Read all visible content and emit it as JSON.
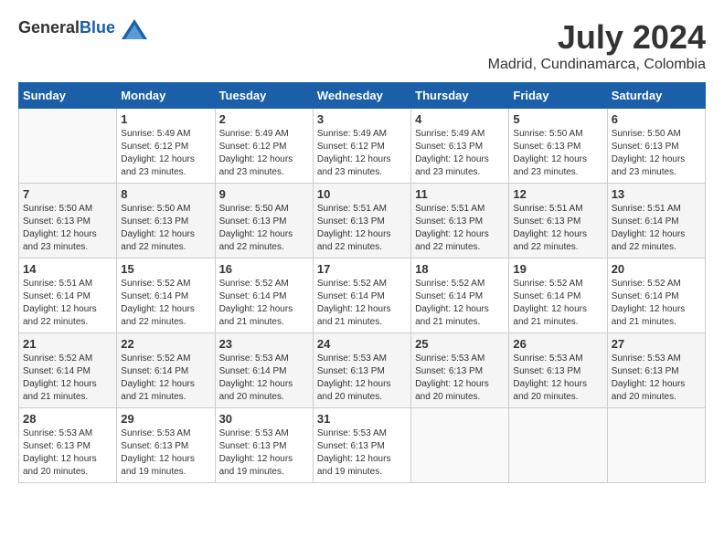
{
  "header": {
    "logo_general": "General",
    "logo_blue": "Blue",
    "month_year": "July 2024",
    "location": "Madrid, Cundinamarca, Colombia"
  },
  "days_of_week": [
    "Sunday",
    "Monday",
    "Tuesday",
    "Wednesday",
    "Thursday",
    "Friday",
    "Saturday"
  ],
  "weeks": [
    [
      {
        "day": "",
        "info": ""
      },
      {
        "day": "1",
        "info": "Sunrise: 5:49 AM\nSunset: 6:12 PM\nDaylight: 12 hours\nand 23 minutes."
      },
      {
        "day": "2",
        "info": "Sunrise: 5:49 AM\nSunset: 6:12 PM\nDaylight: 12 hours\nand 23 minutes."
      },
      {
        "day": "3",
        "info": "Sunrise: 5:49 AM\nSunset: 6:12 PM\nDaylight: 12 hours\nand 23 minutes."
      },
      {
        "day": "4",
        "info": "Sunrise: 5:49 AM\nSunset: 6:13 PM\nDaylight: 12 hours\nand 23 minutes."
      },
      {
        "day": "5",
        "info": "Sunrise: 5:50 AM\nSunset: 6:13 PM\nDaylight: 12 hours\nand 23 minutes."
      },
      {
        "day": "6",
        "info": "Sunrise: 5:50 AM\nSunset: 6:13 PM\nDaylight: 12 hours\nand 23 minutes."
      }
    ],
    [
      {
        "day": "7",
        "info": "Sunrise: 5:50 AM\nSunset: 6:13 PM\nDaylight: 12 hours\nand 23 minutes."
      },
      {
        "day": "8",
        "info": "Sunrise: 5:50 AM\nSunset: 6:13 PM\nDaylight: 12 hours\nand 22 minutes."
      },
      {
        "day": "9",
        "info": "Sunrise: 5:50 AM\nSunset: 6:13 PM\nDaylight: 12 hours\nand 22 minutes."
      },
      {
        "day": "10",
        "info": "Sunrise: 5:51 AM\nSunset: 6:13 PM\nDaylight: 12 hours\nand 22 minutes."
      },
      {
        "day": "11",
        "info": "Sunrise: 5:51 AM\nSunset: 6:13 PM\nDaylight: 12 hours\nand 22 minutes."
      },
      {
        "day": "12",
        "info": "Sunrise: 5:51 AM\nSunset: 6:13 PM\nDaylight: 12 hours\nand 22 minutes."
      },
      {
        "day": "13",
        "info": "Sunrise: 5:51 AM\nSunset: 6:14 PM\nDaylight: 12 hours\nand 22 minutes."
      }
    ],
    [
      {
        "day": "14",
        "info": "Sunrise: 5:51 AM\nSunset: 6:14 PM\nDaylight: 12 hours\nand 22 minutes."
      },
      {
        "day": "15",
        "info": "Sunrise: 5:52 AM\nSunset: 6:14 PM\nDaylight: 12 hours\nand 22 minutes."
      },
      {
        "day": "16",
        "info": "Sunrise: 5:52 AM\nSunset: 6:14 PM\nDaylight: 12 hours\nand 21 minutes."
      },
      {
        "day": "17",
        "info": "Sunrise: 5:52 AM\nSunset: 6:14 PM\nDaylight: 12 hours\nand 21 minutes."
      },
      {
        "day": "18",
        "info": "Sunrise: 5:52 AM\nSunset: 6:14 PM\nDaylight: 12 hours\nand 21 minutes."
      },
      {
        "day": "19",
        "info": "Sunrise: 5:52 AM\nSunset: 6:14 PM\nDaylight: 12 hours\nand 21 minutes."
      },
      {
        "day": "20",
        "info": "Sunrise: 5:52 AM\nSunset: 6:14 PM\nDaylight: 12 hours\nand 21 minutes."
      }
    ],
    [
      {
        "day": "21",
        "info": "Sunrise: 5:52 AM\nSunset: 6:14 PM\nDaylight: 12 hours\nand 21 minutes."
      },
      {
        "day": "22",
        "info": "Sunrise: 5:52 AM\nSunset: 6:14 PM\nDaylight: 12 hours\nand 21 minutes."
      },
      {
        "day": "23",
        "info": "Sunrise: 5:53 AM\nSunset: 6:14 PM\nDaylight: 12 hours\nand 20 minutes."
      },
      {
        "day": "24",
        "info": "Sunrise: 5:53 AM\nSunset: 6:13 PM\nDaylight: 12 hours\nand 20 minutes."
      },
      {
        "day": "25",
        "info": "Sunrise: 5:53 AM\nSunset: 6:13 PM\nDaylight: 12 hours\nand 20 minutes."
      },
      {
        "day": "26",
        "info": "Sunrise: 5:53 AM\nSunset: 6:13 PM\nDaylight: 12 hours\nand 20 minutes."
      },
      {
        "day": "27",
        "info": "Sunrise: 5:53 AM\nSunset: 6:13 PM\nDaylight: 12 hours\nand 20 minutes."
      }
    ],
    [
      {
        "day": "28",
        "info": "Sunrise: 5:53 AM\nSunset: 6:13 PM\nDaylight: 12 hours\nand 20 minutes."
      },
      {
        "day": "29",
        "info": "Sunrise: 5:53 AM\nSunset: 6:13 PM\nDaylight: 12 hours\nand 19 minutes."
      },
      {
        "day": "30",
        "info": "Sunrise: 5:53 AM\nSunset: 6:13 PM\nDaylight: 12 hours\nand 19 minutes."
      },
      {
        "day": "31",
        "info": "Sunrise: 5:53 AM\nSunset: 6:13 PM\nDaylight: 12 hours\nand 19 minutes."
      },
      {
        "day": "",
        "info": ""
      },
      {
        "day": "",
        "info": ""
      },
      {
        "day": "",
        "info": ""
      }
    ]
  ]
}
